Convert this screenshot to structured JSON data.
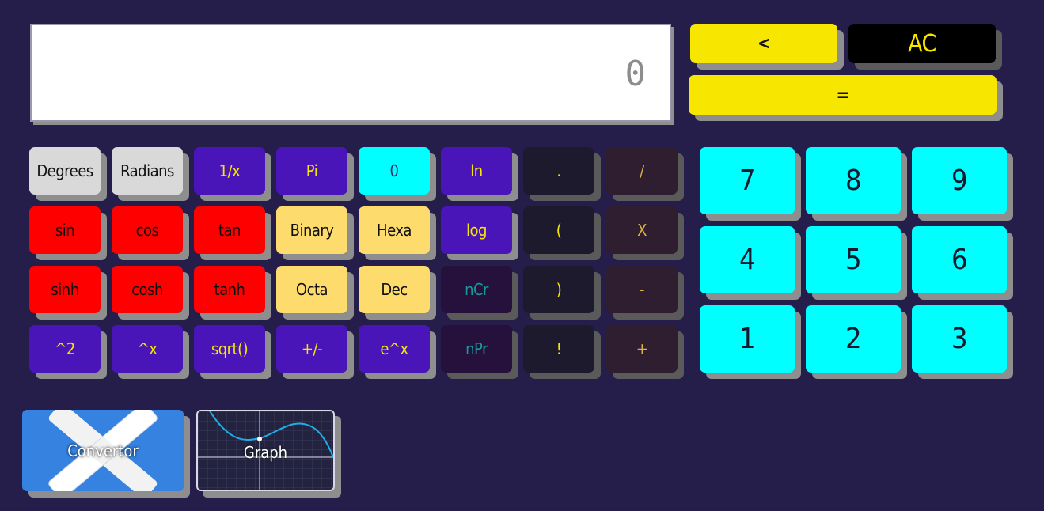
{
  "display": {
    "value": "0"
  },
  "top_buttons": {
    "back": "<",
    "ac": "AC",
    "equals": "="
  },
  "keys": [
    [
      "Degrees",
      "Radians",
      "1/x",
      "Pi",
      "0",
      "ln",
      ".",
      "/"
    ],
    [
      "sin",
      "cos",
      "tan",
      "Binary",
      "Hexa",
      "log",
      "(",
      "X"
    ],
    [
      "sinh",
      "cosh",
      "tanh",
      "Octa",
      "Dec",
      "nCr",
      ")",
      "-"
    ],
    [
      "^2",
      "^x",
      "sqrt()",
      "+/-",
      "e^x",
      "nPr",
      "!",
      "+"
    ]
  ],
  "number_pad": [
    [
      "7",
      "8",
      "9"
    ],
    [
      "4",
      "5",
      "6"
    ],
    [
      "1",
      "2",
      "3"
    ]
  ],
  "tiles": {
    "convertor": "Convertor",
    "graph": "Graph"
  },
  "colors": {
    "background": "#251e4b",
    "yellow": "#f7e600",
    "cyan": "#00ffff",
    "red": "#ff0000",
    "purple": "#4a15b8",
    "sand": "#fddb6d",
    "light_gray": "#d9d9d9"
  }
}
